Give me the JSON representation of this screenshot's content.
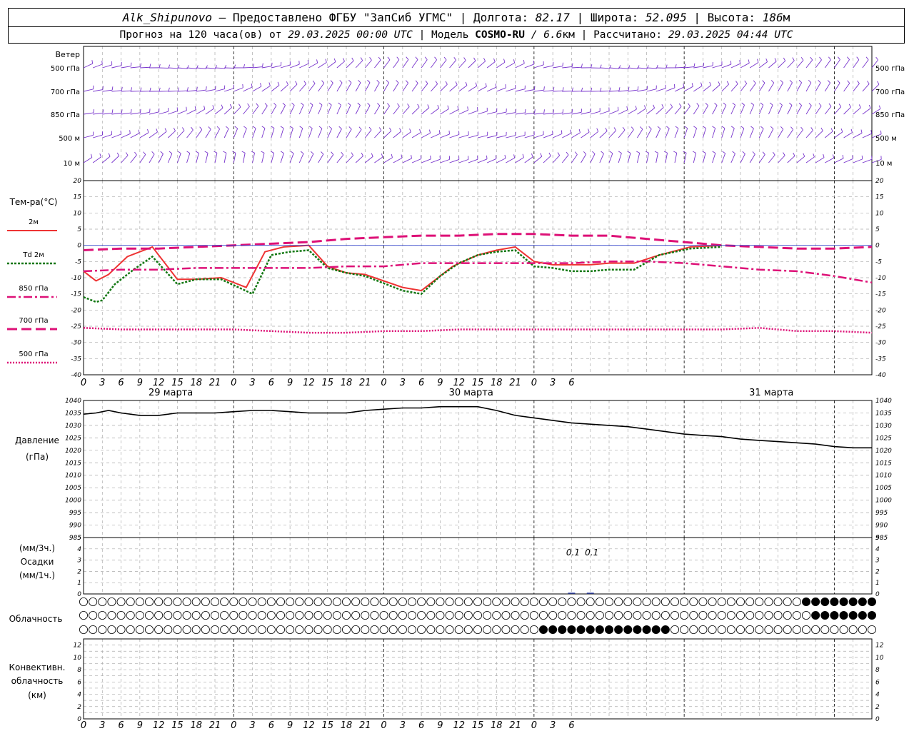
{
  "header": {
    "station": "Alk_Shipunovo",
    "provided_by": "– Предоставлено ФГБУ \"ЗапСиб УГМС\" |",
    "lon_label": "Долгота:",
    "lon_value": "82.17",
    "lat_label": "| Широта:",
    "lat_value": "52.095",
    "alt_label": "| Высота:",
    "alt_value": "186",
    "alt_unit": "м",
    "forecast_prefix": "Прогноз на 120 часа(ов) от",
    "forecast_start": "29.03.2025 00:00 UTC",
    "model_label": "| Модель",
    "model_name": "COSMO-RU",
    "model_res": "/ 6.6",
    "model_res_unit": "км",
    "calc_label": "| Рассчитано:",
    "calc_time": "29.03.2025 04:44 UTC"
  },
  "labels": {
    "wind_title": "Ветер",
    "wind_levels": [
      "500 гПа",
      "700 гПа",
      "850 гПа",
      "500 м",
      "10  м"
    ],
    "temp_title": "Тем-ра(°C)",
    "temp_legend": [
      {
        "label": "2м",
        "color": "#ee3333",
        "dash": "",
        "width": 2
      },
      {
        "label": "Td  2м",
        "color": "#117711",
        "dash": "3,2",
        "width": 2.5
      },
      {
        "label": "850 гПа",
        "color": "#dd1177",
        "dash": "12,4,3,4",
        "width": 2.5
      },
      {
        "label": "700 гПа",
        "color": "#dd1177",
        "dash": "14,6",
        "width": 3
      },
      {
        "label": "500 гПа",
        "color": "#dd1177",
        "dash": "2,2",
        "width": 2.5
      }
    ],
    "pressure_title": "Давление",
    "pressure_unit": "(гПа)",
    "precip_top": "(мм/3ч.)",
    "precip_title": "Осадки",
    "precip_bottom": "(мм/1ч.)",
    "cloud_title": "Облачность",
    "conv_line1": "Конвективн.",
    "conv_line2": "облачность",
    "conv_line3": "(км)"
  },
  "chart_data": {
    "type": "line",
    "time_hours": {
      "start": 0,
      "end": 126,
      "step": 3
    },
    "x_tick_labels": [
      "0",
      "3",
      "6",
      "9",
      "12",
      "15",
      "18",
      "21",
      "0",
      "3",
      "6",
      "9",
      "12",
      "15",
      "18",
      "21",
      "0",
      "3",
      "6",
      "9",
      "12",
      "15",
      "18",
      "21",
      "0",
      "3",
      "6"
    ],
    "day_labels": [
      {
        "label": "29 марта",
        "hour": 12
      },
      {
        "label": "30 марта",
        "hour": 60
      },
      {
        "label": "31 марта",
        "hour": 108
      }
    ],
    "temperature": {
      "ylim": [
        -40,
        20
      ],
      "yticks": [
        "20",
        "15",
        "10",
        "5",
        "0",
        "-5",
        "-10",
        "-15",
        "-20",
        "-25",
        "-30",
        "-35",
        "-40"
      ],
      "series": [
        {
          "name": "2м",
          "color": "#ee3333",
          "dash": "",
          "width": 2,
          "x": [
            0,
            2,
            4,
            7,
            11,
            15,
            18,
            22,
            26,
            29,
            32,
            36,
            39,
            42,
            45,
            51,
            54,
            57,
            59,
            63,
            66,
            69,
            72,
            75,
            78,
            81,
            84,
            88,
            92,
            97,
            102,
            108,
            114,
            117,
            120,
            123,
            126
          ],
          "y": [
            -8,
            -11,
            -9,
            -3.5,
            -0.5,
            -10.5,
            -10.5,
            -10,
            -13,
            -2,
            -0.5,
            0,
            -6.5,
            -8.5,
            -9,
            -13,
            -14,
            -9.5,
            -6.5,
            -3,
            -1.5,
            -0.5,
            -5,
            -6,
            -6,
            -6,
            -5.5,
            -5.5,
            -3,
            -0.5,
            0
          ]
        },
        {
          "name": "Td 2м",
          "color": "#117711",
          "dash": "3,2",
          "width": 2.5,
          "x": [
            0,
            2,
            3,
            5,
            8,
            11,
            15,
            18,
            22,
            27,
            30,
            33,
            36,
            39,
            42,
            45,
            51,
            54,
            57,
            60,
            63,
            66,
            69,
            72,
            75,
            78,
            81,
            84,
            88,
            92,
            97,
            102,
            108,
            114,
            117,
            120,
            123,
            126
          ],
          "y": [
            -16,
            -17.5,
            -17,
            -12,
            -7.5,
            -3.5,
            -12,
            -10.5,
            -10.5,
            -15,
            -3,
            -2,
            -1.5,
            -7,
            -8.5,
            -9.5,
            -14,
            -15,
            -9.5,
            -5.5,
            -3,
            -2,
            -1.5,
            -6.5,
            -7,
            -8,
            -8,
            -7.5,
            -7.5,
            -3,
            -1,
            -0.5
          ]
        },
        {
          "name": "850 гПа",
          "color": "#dd1177",
          "dash": "12,4,3,4",
          "width": 2.5,
          "x": [
            0,
            6,
            12,
            18,
            24,
            30,
            36,
            42,
            48,
            54,
            60,
            66,
            72,
            78,
            84,
            90,
            96,
            102,
            108,
            114,
            120,
            126
          ],
          "y": [
            -8,
            -7.5,
            -7.5,
            -7,
            -7,
            -7,
            -7,
            -6.5,
            -6.5,
            -5.5,
            -5.5,
            -5.5,
            -5.5,
            -5.5,
            -5,
            -5,
            -5.5,
            -6.5,
            -7.5,
            -8,
            -9.5,
            -11.5
          ]
        },
        {
          "name": "700 гПа",
          "color": "#dd1177",
          "dash": "14,6",
          "width": 3,
          "x": [
            0,
            6,
            12,
            18,
            24,
            30,
            36,
            42,
            48,
            54,
            60,
            66,
            72,
            78,
            84,
            90,
            96,
            102,
            108,
            114,
            120,
            126
          ],
          "y": [
            -1.5,
            -1,
            -1,
            -0.5,
            0,
            0.5,
            1,
            2,
            2.5,
            3,
            3,
            3.5,
            3.5,
            3,
            3,
            2,
            1,
            0,
            -0.5,
            -1,
            -1,
            -0.5
          ]
        },
        {
          "name": "500 гПа",
          "color": "#dd1177",
          "dash": "2,2",
          "width": 2.5,
          "x": [
            0,
            6,
            12,
            18,
            24,
            30,
            36,
            42,
            48,
            54,
            60,
            66,
            72,
            78,
            84,
            90,
            96,
            102,
            108,
            114,
            120,
            126
          ],
          "y": [
            -25.5,
            -26,
            -26,
            -26,
            -26,
            -26.5,
            -27,
            -27,
            -26.5,
            -26.5,
            -26,
            -26,
            -26,
            -26,
            -26,
            -26,
            -26,
            -26,
            -25.5,
            -26.5,
            -26.5,
            -27
          ]
        },
        {
          "name": "0",
          "color": "#3344cc",
          "dash": "",
          "width": 0.8,
          "x": [
            0,
            126
          ],
          "y": [
            0,
            0
          ]
        }
      ]
    },
    "pressure": {
      "ylim": [
        985,
        1040
      ],
      "yticks": [
        "1040",
        "1035",
        "1030",
        "1025",
        "1020",
        "1015",
        "1010",
        "1005",
        "1000",
        "995",
        "990",
        "985"
      ],
      "x": [
        0,
        2,
        4,
        6,
        9,
        12,
        15,
        18,
        21,
        24,
        27,
        30,
        33,
        36,
        39,
        42,
        45,
        48,
        51,
        54,
        57,
        60,
        63,
        66,
        69,
        72,
        75,
        78,
        81,
        84,
        87,
        90,
        93,
        96,
        99,
        102,
        105,
        108,
        111,
        114,
        117,
        120,
        123,
        126
      ],
      "y": [
        1034.5,
        1035,
        1036,
        1035,
        1034,
        1034,
        1035,
        1035,
        1035,
        1035.5,
        1036,
        1036,
        1035.5,
        1035,
        1035,
        1035,
        1036,
        1036.5,
        1037,
        1037,
        1037.5,
        1037.5,
        1037.5,
        1036,
        1034,
        1033,
        1032,
        1031,
        1030.5,
        1030,
        1029.5,
        1028.5,
        1027.5,
        1026.5,
        1026,
        1025.5,
        1024.5,
        1024,
        1023.5,
        1023,
        1022.5,
        1021.5,
        1021,
        1021
      ]
    },
    "precip": {
      "ylim": [
        0,
        5
      ],
      "yticks": [
        "5",
        "4",
        "3",
        "2",
        "1",
        "0"
      ],
      "annotations": [
        {
          "hour": 78,
          "value": "0.1"
        },
        {
          "hour": 81,
          "value": "0.1"
        }
      ]
    },
    "clouds": {
      "rows": 3,
      "filled_ranges": [
        {
          "row": 0,
          "from": 115,
          "to": 126,
          "level": 1
        },
        {
          "row": 0,
          "from": 33,
          "to": 34,
          "level": 0.5
        },
        {
          "row": 1,
          "from": 117,
          "to": 126,
          "level": 1
        },
        {
          "row": 2,
          "from": 73,
          "to": 93,
          "level": 1
        }
      ]
    },
    "convective": {
      "ylim": [
        0,
        13
      ],
      "yticks": [
        "12",
        "10",
        "8",
        "6",
        "4",
        "2",
        "0"
      ]
    },
    "wind": {
      "levels": 5
    }
  }
}
